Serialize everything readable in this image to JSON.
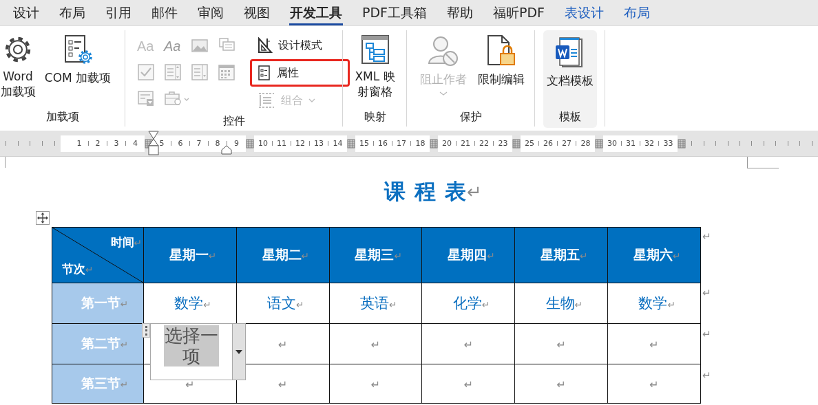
{
  "tabs": [
    {
      "label": "设计",
      "selected": false,
      "kind": "normal"
    },
    {
      "label": "布局",
      "selected": false,
      "kind": "normal"
    },
    {
      "label": "引用",
      "selected": false,
      "kind": "normal"
    },
    {
      "label": "邮件",
      "selected": false,
      "kind": "normal"
    },
    {
      "label": "审阅",
      "selected": false,
      "kind": "normal"
    },
    {
      "label": "视图",
      "selected": false,
      "kind": "normal"
    },
    {
      "label": "开发工具",
      "selected": true,
      "kind": "normal"
    },
    {
      "label": "PDF工具箱",
      "selected": false,
      "kind": "normal"
    },
    {
      "label": "帮助",
      "selected": false,
      "kind": "normal"
    },
    {
      "label": "福昕PDF",
      "selected": false,
      "kind": "normal"
    },
    {
      "label": "表设计",
      "selected": false,
      "kind": "contextual"
    },
    {
      "label": "布局",
      "selected": false,
      "kind": "contextual"
    }
  ],
  "ribbon": {
    "addins": {
      "label": "加载项",
      "buttons": [
        "Word 加载项",
        "COM 加载项"
      ]
    },
    "controls": {
      "label": "控件",
      "gallery_disabled": true,
      "gallery_glyphs": [
        "Aa",
        "Aa"
      ],
      "design_mode": {
        "label": "设计模式"
      },
      "properties": {
        "label": "属性",
        "highlighted": true
      },
      "group": {
        "label": "组合",
        "disabled": true
      }
    },
    "mapping": {
      "label": "映射",
      "button": "XML 映射窗格"
    },
    "protect": {
      "label": "保护",
      "buttons": [
        {
          "label": "阻止作者",
          "disabled": true
        },
        {
          "label": "限制编辑",
          "disabled": false
        }
      ]
    },
    "templates": {
      "label": "模板",
      "button": {
        "label": "文档模板",
        "hovered": true
      }
    }
  },
  "ruler": {
    "segments": [
      [
        "1",
        "2",
        "3",
        "4"
      ],
      [
        "5",
        "6",
        "7",
        "8",
        "9"
      ],
      [
        "10",
        "11",
        "12",
        "13",
        "14"
      ],
      [
        "15",
        "16",
        "17",
        "18"
      ],
      [
        "20",
        "21",
        "22",
        "23"
      ],
      [
        "25",
        "26",
        "27",
        "28"
      ],
      [
        "30",
        "31",
        "32",
        "33"
      ]
    ]
  },
  "document": {
    "title": "课 程 表",
    "title_mark": "↵",
    "table": {
      "corner": {
        "top": "时间",
        "bottom": "节次",
        "mark": "↵"
      },
      "columns": [
        {
          "text": "星期一",
          "mark": "↵"
        },
        {
          "text": "星期二",
          "mark": "↵"
        },
        {
          "text": "星期三",
          "mark": "↵"
        },
        {
          "text": "星期四",
          "mark": "↵"
        },
        {
          "text": "星期五",
          "mark": "↵"
        },
        {
          "text": "星期六",
          "mark": "↵"
        }
      ],
      "header_end_mark": "↵",
      "rows": [
        {
          "label": "第一节",
          "mark": "↵",
          "end_mark": "↵",
          "cells": [
            {
              "text": "数学",
              "mark": "↵"
            },
            {
              "text": "语文",
              "mark": "↵"
            },
            {
              "text": "英语",
              "mark": "↵"
            },
            {
              "text": "化学",
              "mark": "↵"
            },
            {
              "text": "生物",
              "mark": "↵"
            },
            {
              "text": "数学",
              "mark": "↵"
            }
          ]
        },
        {
          "label": "第二节",
          "mark": "↵",
          "end_mark": "↵",
          "cells": [
            {
              "kind": "dropdown",
              "text": "选择一项"
            },
            {
              "mark": "↵"
            },
            {
              "mark": "↵"
            },
            {
              "mark": "↵"
            },
            {
              "mark": "↵"
            },
            {
              "mark": "↵"
            }
          ]
        },
        {
          "label": "第三节",
          "mark": "↵",
          "end_mark": "↵",
          "cells": [
            {
              "mark": "↵"
            },
            {
              "mark": "↵"
            },
            {
              "mark": "↵"
            },
            {
              "mark": "↵"
            },
            {
              "mark": "↵"
            },
            {
              "mark": "↵"
            }
          ]
        }
      ]
    }
  }
}
